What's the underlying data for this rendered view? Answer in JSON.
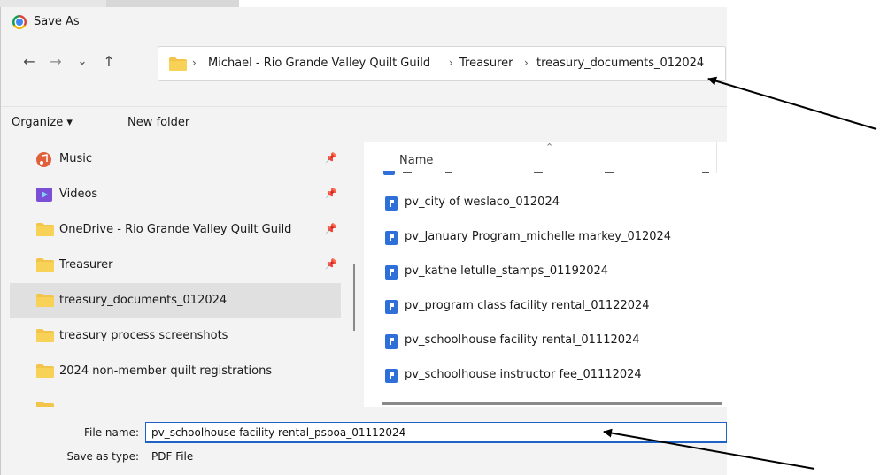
{
  "window": {
    "title": "Save As",
    "icon": "chrome-icon"
  },
  "nav": {
    "back_icon": "←",
    "forward_icon": "→",
    "recent_icon": "⌄",
    "up_icon": "↑",
    "breadcrumb_sep": "›",
    "breadcrumbs": [
      "Michael - Rio Grande Valley Quilt Guild",
      "Treasurer",
      "treasury_documents_012024"
    ]
  },
  "toolbar": {
    "organize": "Organize ▾",
    "new_folder": "New folder"
  },
  "sidebar": {
    "items": [
      {
        "label": "Music",
        "icon": "music-icon",
        "pinned": true
      },
      {
        "label": "Videos",
        "icon": "videos-icon",
        "pinned": true
      },
      {
        "label": "OneDrive - Rio Grande Valley Quilt Guild",
        "icon": "folder-icon",
        "pinned": true
      },
      {
        "label": "Treasurer",
        "icon": "folder-icon",
        "pinned": true
      },
      {
        "label": "treasury_documents_012024",
        "icon": "folder-icon",
        "pinned": false,
        "selected": true
      },
      {
        "label": "treasury process screenshots",
        "icon": "folder-icon",
        "pinned": false
      },
      {
        "label": "2024 non-member quilt registrations",
        "icon": "folder-icon",
        "pinned": false
      }
    ],
    "pin_glyph": "📌"
  },
  "filelist": {
    "column_name": "Name",
    "sort_glyph": "⌃",
    "files": [
      "pv_city of weslaco_012024",
      "pv_January Program_michelle markey_012024",
      "pv_kathe letulle_stamps_01192024",
      "pv_program class facility rental_01122024",
      "pv_schoolhouse facility rental_01112024",
      "pv_schoolhouse instructor fee_01112024"
    ]
  },
  "save": {
    "filename_label": "File name:",
    "filename_value": "pv_schoolhouse facility rental_pspoa_01112024",
    "type_label": "Save as type:",
    "type_value": "PDF File"
  },
  "colors": {
    "accent": "#1f62c7",
    "folder": "#f3c44a",
    "file_icon": "#2f6fd8",
    "selection": "#e0e0e0"
  }
}
